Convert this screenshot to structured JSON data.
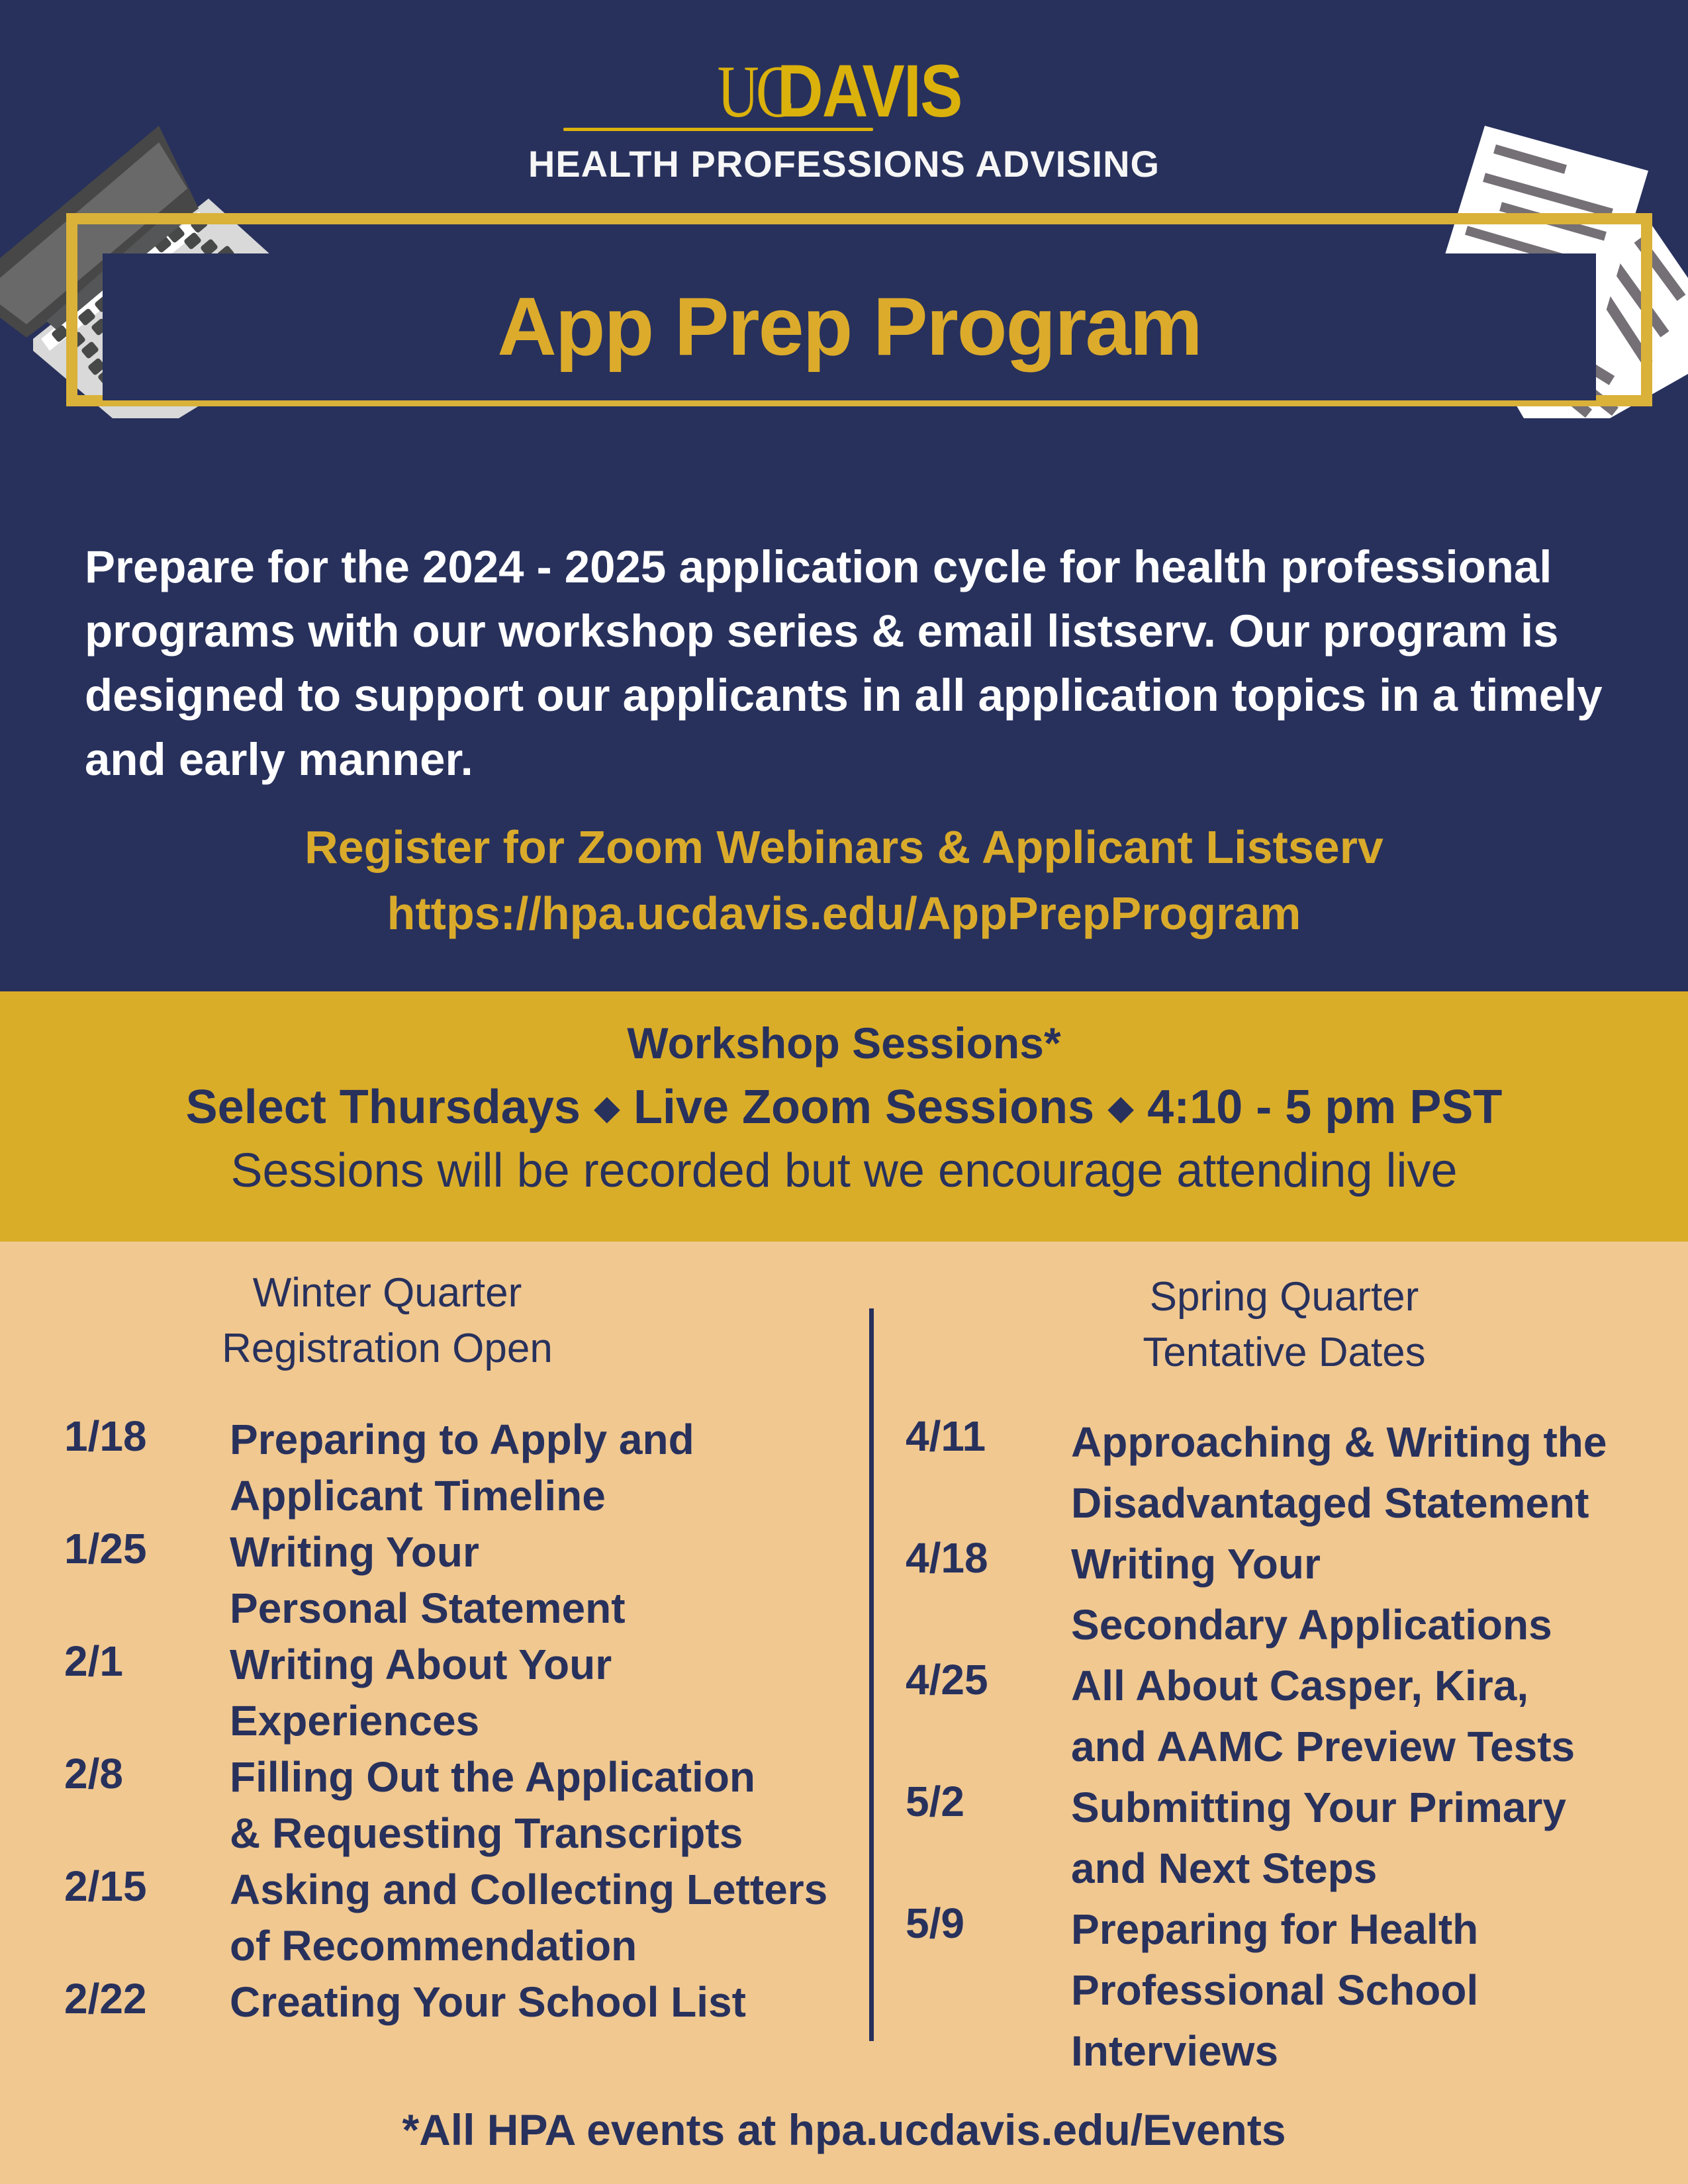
{
  "header": {
    "logo_uc": "UC",
    "logo_davis": "DAVIS",
    "subtitle": "HEALTH PROFESSIONS ADVISING",
    "title": "App Prep Program"
  },
  "intro": {
    "text": "Prepare for the 2024 - 2025 application cycle for health professional programs with our workshop series & email listserv. Our program is designed to support our applicants in all application topics in a timely and early manner."
  },
  "register": {
    "label": "Register for Zoom Webinars & Applicant Listserv",
    "url": "https://hpa.ucdavis.edu/AppPrepProgram"
  },
  "workshop": {
    "title": "Workshop Sessions*",
    "details": [
      "Select Thursdays",
      "Live Zoom Sessions",
      "4:10 - 5 pm PST"
    ],
    "separator": "◆",
    "note": "Sessions will be recorded but we encourage attending live"
  },
  "winter": {
    "heading_line1": "Winter Quarter",
    "heading_line2": "Registration Open",
    "sessions": [
      {
        "date": "1/18",
        "topic_line1": "Preparing to Apply and",
        "topic_line2": "Applicant Timeline"
      },
      {
        "date": "1/25",
        "topic_line1": "Writing Your",
        "topic_line2": "Personal Statement"
      },
      {
        "date": "2/1",
        "topic_line1": "Writing About Your",
        "topic_line2": "Experiences"
      },
      {
        "date": "2/8",
        "topic_line1": "Filling Out the Application",
        "topic_line2": "& Requesting Transcripts"
      },
      {
        "date": "2/15",
        "topic_line1": "Asking and Collecting Letters",
        "topic_line2": "of Recommendation"
      },
      {
        "date": "2/22",
        "topic_line1": "Creating Your School List",
        "topic_line2": ""
      }
    ]
  },
  "spring": {
    "heading_line1": "Spring Quarter",
    "heading_line2": "Tentative Dates",
    "sessions": [
      {
        "date": "4/11",
        "topic_line1": "Approaching & Writing the",
        "topic_line2": "Disadvantaged Statement",
        "topic_line3": ""
      },
      {
        "date": "4/18",
        "topic_line1": "Writing Your",
        "topic_line2": "Secondary Applications",
        "topic_line3": ""
      },
      {
        "date": "4/25",
        "topic_line1": "All About Casper, Kira,",
        "topic_line2": "and AAMC Preview Tests",
        "topic_line3": ""
      },
      {
        "date": "5/2",
        "topic_line1": "Submitting Your Primary",
        "topic_line2": "and Next Steps",
        "topic_line3": ""
      },
      {
        "date": "5/9",
        "topic_line1": "Preparing for Health",
        "topic_line2": "Professional School",
        "topic_line3": "Interviews"
      }
    ]
  },
  "footer": {
    "text": "*All HPA events at hpa.ucdavis.edu/Events"
  },
  "colors": {
    "navy": "#28315c",
    "gold": "#daad29",
    "tan": "#f0c890",
    "logo_gold": "#dbb10c"
  }
}
